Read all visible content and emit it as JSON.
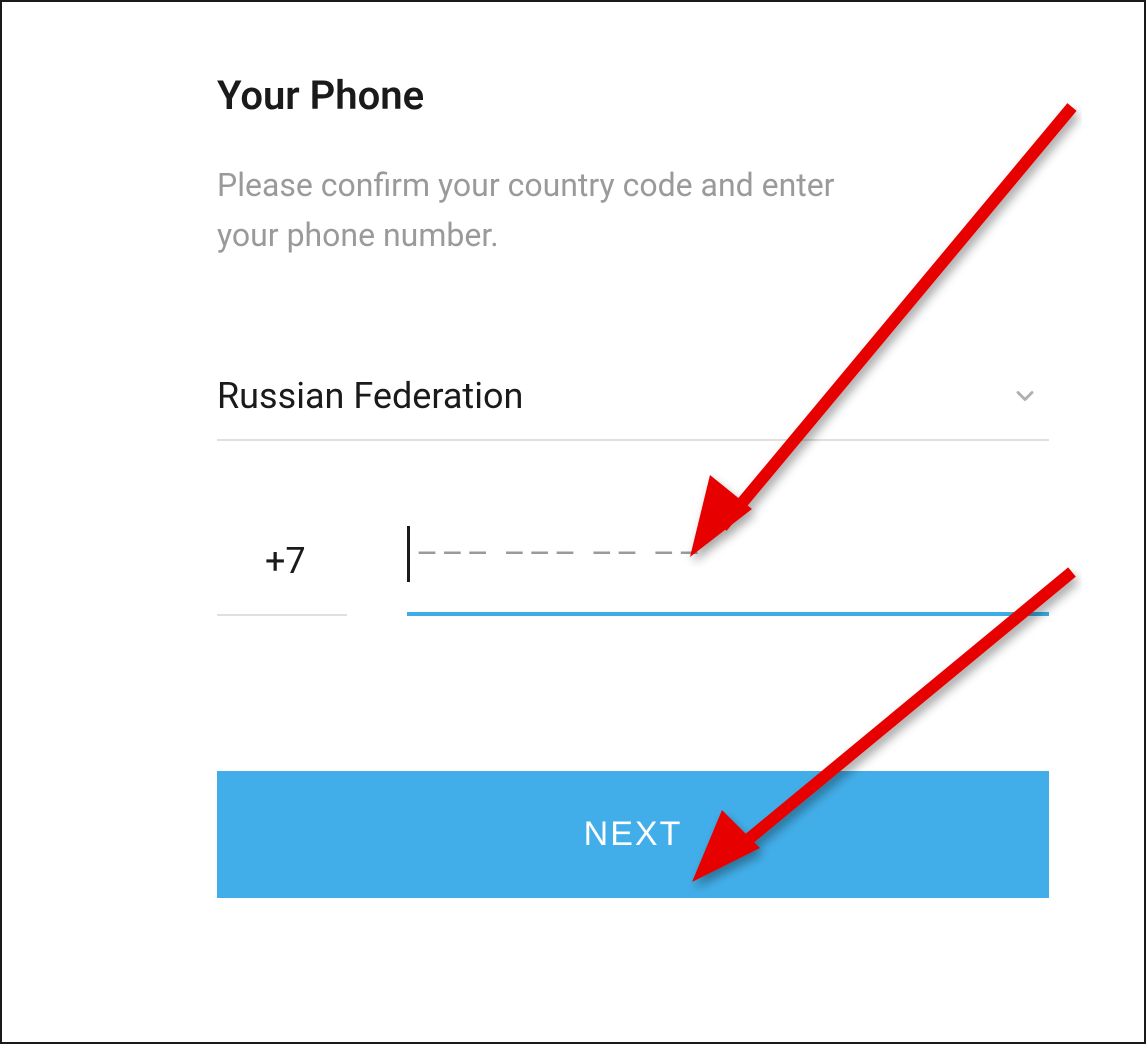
{
  "header": {
    "title": "Your Phone",
    "subtitle": "Please confirm your country code and enter your phone number."
  },
  "country": {
    "selected": "Russian Federation"
  },
  "phone": {
    "code": "+7",
    "placeholder": "––– ––– –– ––"
  },
  "button": {
    "next_label": "NEXT"
  }
}
